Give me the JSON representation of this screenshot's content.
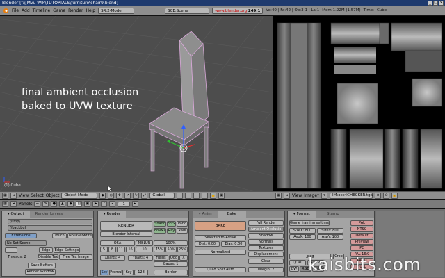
{
  "window": {
    "title": "Blender [f:\\[Mvu-WIP\\TUTORIALS\\furniture\\chair9.blend]",
    "controls": [
      "_",
      "□",
      "×"
    ]
  },
  "menubar": {
    "items": [
      "File",
      "Add",
      "Timeline",
      "Game",
      "Render",
      "Help"
    ],
    "screen": "SR:2-Model",
    "scene": "SCE:Scene",
    "url_prefix": "www.blender.org",
    "url_version": "249.1",
    "stats": "Ve:40 | Fa:42 | Ob:3-1 | La:1",
    "mem": "Mem:1.22M (1.57M)",
    "time": "Time:",
    "object": "Cube"
  },
  "viewport": {
    "overlay_line1": "final ambient occlusion",
    "overlay_line2": "baked to UVW texture",
    "object_label": "(1) Cube"
  },
  "view3d_header": {
    "items": [
      "View",
      "Select",
      "Object"
    ],
    "mode": "Object Mode",
    "orientation": "Global"
  },
  "image_header": {
    "items": [
      "View",
      "Image*"
    ],
    "image_name": "IM:occ4CHECKER.tga"
  },
  "panels_bar": {
    "label": "Panels",
    "page": "1"
  },
  "output_panel": {
    "tab_output": "Output",
    "tab_render_layers": "Render Layers",
    "path1": "//tmp\\",
    "path2": "//backbuf",
    "extensions": "Extensions",
    "touch": "Touch",
    "no_overwrite": "No Overwrite",
    "no_set_scene": "No Set Scene",
    "edge": "Edge",
    "edge_settings": "Edge Settings",
    "threads": "Threads: 2",
    "disable_tex": "Disable Tex",
    "free_tex_image": "Free Tex Image",
    "save_buffers": "Save Buffers",
    "render_window": "Render Window"
  },
  "render_panel": {
    "tab": "Render",
    "render_btn": "RENDER",
    "engine": "Blender Internal",
    "shadow": "Shado",
    "sss": "SSS",
    "pano": "Pano",
    "envmap": "EnvMa",
    "ray": "Ray",
    "radio": "Radi",
    "osa": "OSA",
    "mblur": "MBLUR",
    "pct100": "100%",
    "osa_5": "5",
    "osa_8": "8",
    "osa_11": "11",
    "osa_16": "16",
    "val_10": "10",
    "pct75": "75%",
    "pct50": "50%",
    "pct25": "25%",
    "xparts": "Xparts: 4",
    "yparts": "Yparts: 4",
    "fields": "Fields",
    "odd": "Odd",
    "x": "X",
    "gauss": "Gauss: 1",
    "sky": "Sky",
    "premul": "Premul",
    "key": "Key",
    "v128": "128",
    "border": "Border"
  },
  "bake_panel": {
    "tab_anim": "Anim",
    "tab_bake": "Bake",
    "bake_btn": "BAKE",
    "full_render": "Full Render",
    "ambient_occlusion": "Ambient Occlusio",
    "shadow": "Shadow",
    "normals": "Normals",
    "textures": "Textures",
    "displacement": "Displacement",
    "selected_to_active": "Selected to Active",
    "dist": "Dist: 0.00",
    "bias": "Bias: 0.00",
    "normalized": "Normalized",
    "clear": "Clear",
    "quad_split": "Quad Split Auto",
    "margin": "Margin: 2"
  },
  "format_panel": {
    "tab_format": "Format",
    "tab_stamp": "Stamp",
    "game_framing": "Game framing settings",
    "sizex": "SizeX: 800",
    "sizey": "SizeY: 800",
    "aspx": "AspX: 100",
    "aspy": "AspY: 100",
    "format": "Jpeg",
    "crop": "Crop",
    "q": "Q: 90",
    "fps": "FPS: 25",
    "bw": "BW",
    "rgb": "RGB",
    "rgba": "RGBA",
    "pal": "PAL",
    "ntsc": "NTSC",
    "default": "Default",
    "preview": "Preview",
    "pc": "PC",
    "pal169": "PAL 16:9",
    "pano": "PANO",
    "full": "FULL"
  },
  "watermark": "kaisbits.com"
}
